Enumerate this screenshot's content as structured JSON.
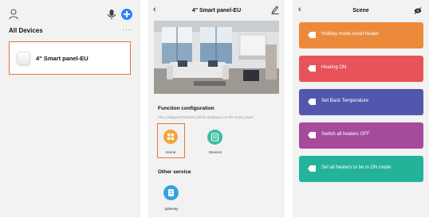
{
  "panel1": {
    "section_title": "All Devices",
    "more": "···",
    "device_name": "4\" Smart panel-EU",
    "colors": {
      "accent_border": "#e8733a",
      "add_button": "#2b83f6"
    }
  },
  "panel2": {
    "title": "4\" Smart panel-EU",
    "function_title": "Function configuration",
    "function_subtitle": "The configured function will be displayed on the smart panel",
    "tiles": [
      {
        "label": "Scene",
        "icon": "scene-grid-icon",
        "color": "#f5a43d",
        "selected": true
      },
      {
        "label": "Devices",
        "icon": "devices-icon",
        "color": "#3dbda3",
        "selected": false
      }
    ],
    "other_title": "Other service",
    "gateway_label": "gateway",
    "gateway_color": "#35a3dd"
  },
  "panel3": {
    "title": "Scene",
    "scenes": [
      {
        "label": "Holiday mode smart heater",
        "color": "#ec8a3c"
      },
      {
        "label": "Heating ON",
        "color": "#e8535a"
      },
      {
        "label": "Set Back Temperature",
        "color": "#5257ad"
      },
      {
        "label": "Switch all heaters OFF",
        "color": "#a64a9a"
      },
      {
        "label": "Set all heaters to be in ON mode",
        "color": "#23b39b"
      }
    ]
  }
}
